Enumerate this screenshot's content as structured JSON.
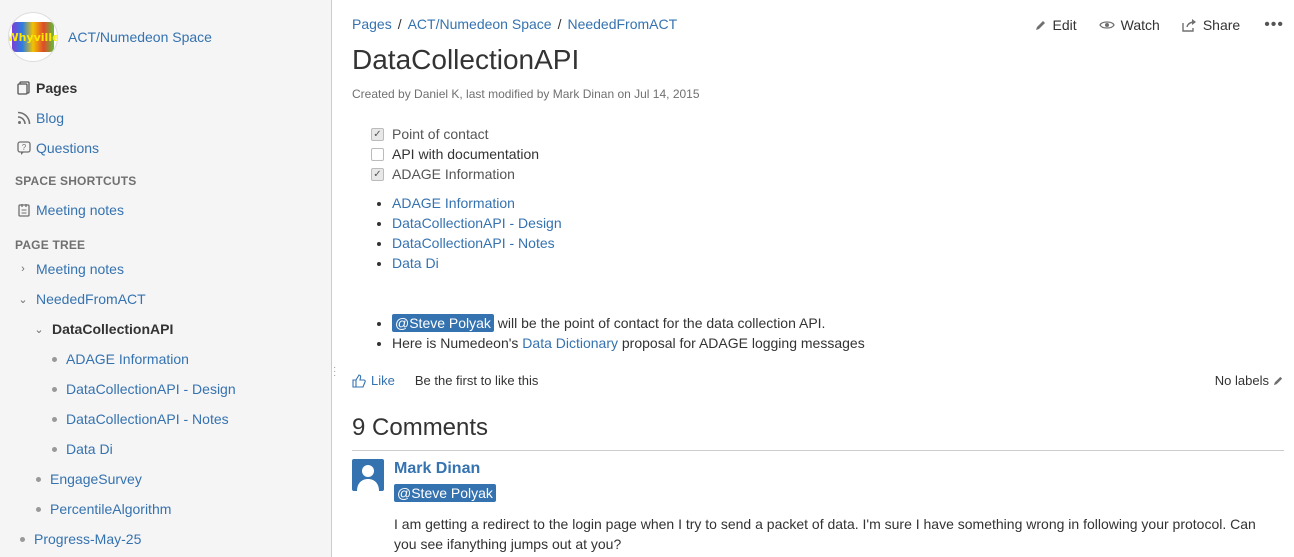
{
  "sidebar": {
    "space_name": "ACT/Numedeon Space",
    "logo_text": "Whyville",
    "nav": [
      {
        "label": "Pages",
        "icon": "pages-icon"
      },
      {
        "label": "Blog",
        "icon": "blog-icon"
      },
      {
        "label": "Questions",
        "icon": "questions-icon"
      }
    ],
    "shortcuts_heading": "SPACE SHORTCUTS",
    "shortcuts": [
      {
        "label": "Meeting notes",
        "icon": "meeting-notes-icon"
      }
    ],
    "tree_heading": "PAGE TREE",
    "tree": [
      {
        "label": "Meeting notes"
      },
      {
        "label": "NeededFromACT"
      },
      {
        "label": "DataCollectionAPI"
      },
      {
        "label": "ADAGE Information"
      },
      {
        "label": "DataCollectionAPI - Design"
      },
      {
        "label": "DataCollectionAPI - Notes"
      },
      {
        "label": "Data Di"
      },
      {
        "label": "EngageSurvey"
      },
      {
        "label": "PercentileAlgorithm"
      },
      {
        "label": "Progress-May-25"
      }
    ]
  },
  "breadcrumb": [
    "Pages",
    "ACT/Numedeon Space",
    "NeededFromACT"
  ],
  "actions": {
    "edit": "Edit",
    "watch": "Watch",
    "share": "Share"
  },
  "page": {
    "title": "DataCollectionAPI",
    "byline": "Created by Daniel K, last modified by Mark Dinan on Jul 14, 2015",
    "tasks": [
      {
        "label": "Point of contact",
        "checked": true
      },
      {
        "label": "API with documentation",
        "checked": false
      },
      {
        "label": "ADAGE Information",
        "checked": true
      }
    ],
    "links": [
      "ADAGE Information",
      "DataCollectionAPI - Design",
      "DataCollectionAPI - Notes",
      "Data Di"
    ],
    "note1_mention": "@Steve Polyak",
    "note1_rest": " will be the point of contact for the data collection API.",
    "note2_before": "Here is Numedeon's ",
    "note2_link": "Data Dictionary",
    "note2_after": " proposal for ADAGE logging messages"
  },
  "likes": {
    "like": "Like",
    "first": "Be the first to like this",
    "labels": "No labels"
  },
  "comments": {
    "heading": "9 Comments",
    "items": [
      {
        "author": "Mark Dinan",
        "mention": "@Steve Polyak",
        "body": "I am getting a redirect to the login page when I try to send a packet of data.  I'm sure I have something wrong in following your protocol.  Can you see ifanything jumps out at you?"
      }
    ]
  },
  "colors": {
    "link": "#3572b0",
    "sidebar_bg": "#f5f5f5",
    "mention_bg": "#3572b0"
  }
}
